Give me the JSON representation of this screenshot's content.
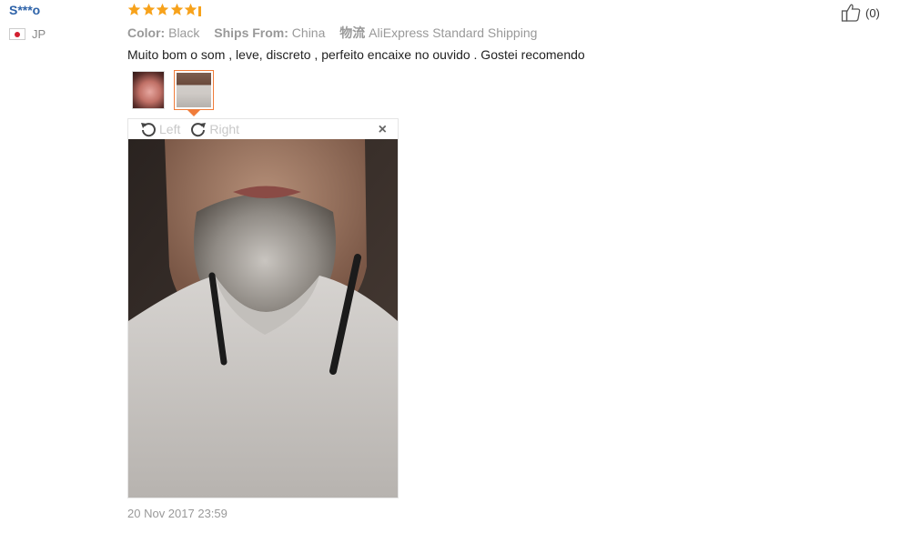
{
  "review": {
    "user": "S***o",
    "country": "JP",
    "rating": 5,
    "color_label": "Color:",
    "color_value": "Black",
    "ships_from_label": "Ships From:",
    "ships_from_value": "China",
    "shipping_label": "物流",
    "shipping_value": "AliExpress Standard Shipping",
    "text": "Muito bom o som , leve, discreto , perfeito encaixe no ouvido . Gostei recomendo",
    "date": "20 Nov 2017 23:59",
    "likes": "(0)"
  },
  "viewer": {
    "rotate_left": "Left",
    "rotate_right": "Right",
    "close": "×"
  },
  "icons": {
    "star": "star-icon",
    "like": "thumbs-up-icon",
    "rotate_left": "rotate-left-icon",
    "rotate_right": "rotate-right-icon",
    "close": "close-icon",
    "flag": "japan-flag-icon"
  },
  "colors": {
    "star": "#f7a21b",
    "username": "#2d62a8",
    "active_thumb_border": "#f07c3a"
  }
}
